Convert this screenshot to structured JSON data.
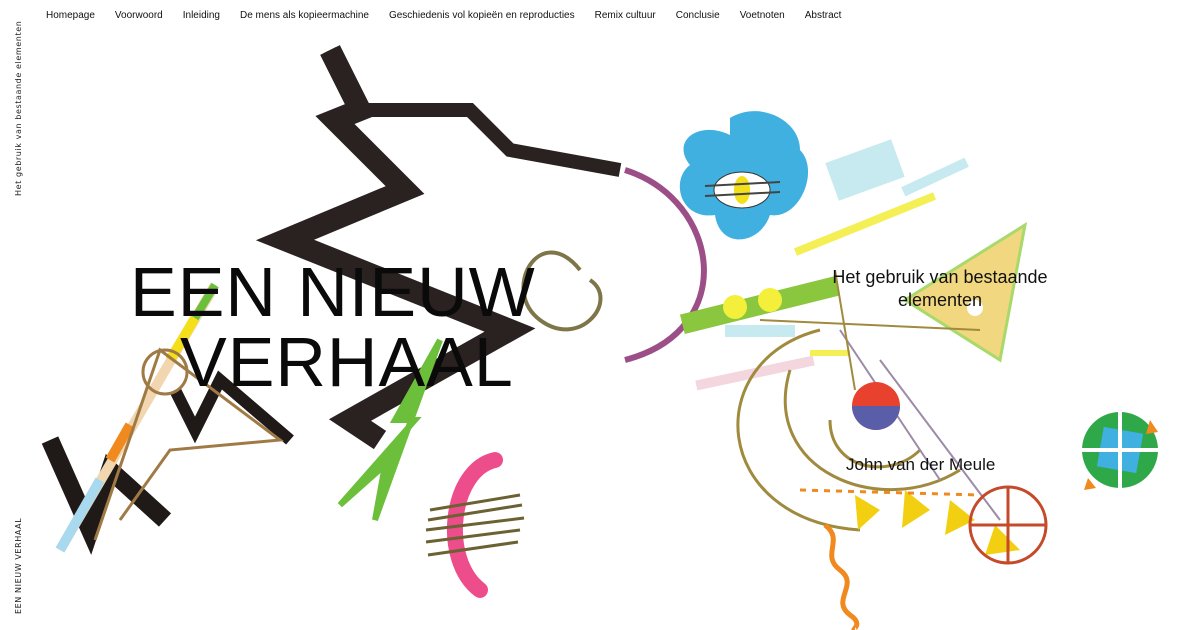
{
  "nav": {
    "items": [
      {
        "label": "Homepage"
      },
      {
        "label": "Voorwoord"
      },
      {
        "label": "Inleiding"
      },
      {
        "label": "De mens als kopieermachine"
      },
      {
        "label": "Geschiedenis vol kopieën en reproducties"
      },
      {
        "label": "Remix cultuur"
      },
      {
        "label": "Conclusie"
      },
      {
        "label": "Voetnoten"
      },
      {
        "label": "Abstract"
      }
    ]
  },
  "side": {
    "top_text": "Het gebruik van bestaande elementen",
    "bottom_text": "EEN NIEUW VERHAAL"
  },
  "hero": {
    "title_line1": "EEN NIEUW",
    "title_line2": "VERHAAL",
    "subtitle": "Het gebruik van bestaande elementen",
    "author": "John van der Meule"
  },
  "colors": {
    "background": "#ffffff",
    "text": "#111111",
    "zigzag": "#2a2220",
    "blue": "#3fb0e0",
    "green": "#6cbf3a",
    "pink": "#ee4d8c",
    "yellow": "#f3df1a",
    "red": "#e8412e",
    "orange": "#f08a1e"
  }
}
